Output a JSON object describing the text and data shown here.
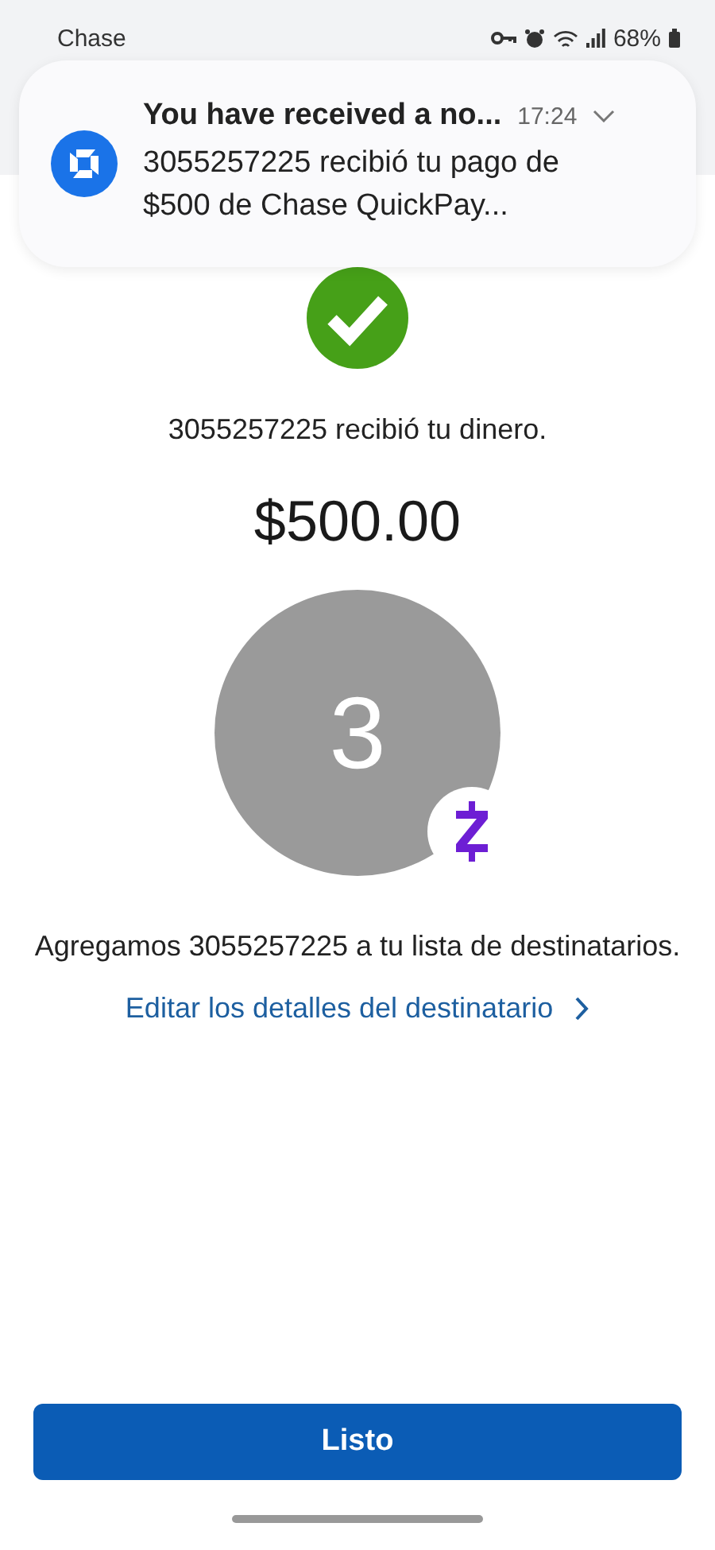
{
  "status_bar": {
    "app": "Chase",
    "battery": "68%"
  },
  "notification": {
    "title": "You have received a no...",
    "time": "17:24",
    "body": "3055257225 recibió tu pago de $500 de Chase QuickPay..."
  },
  "confirmation": {
    "message": "3055257225 recibió tu dinero.",
    "amount": "$500.00",
    "avatar_initial": "3",
    "recipient_note": "Agregamos 3055257225 a tu lista de destinatarios.",
    "edit_link": "Editar los detalles del destinatario"
  },
  "buttons": [
    "Listo"
  ]
}
